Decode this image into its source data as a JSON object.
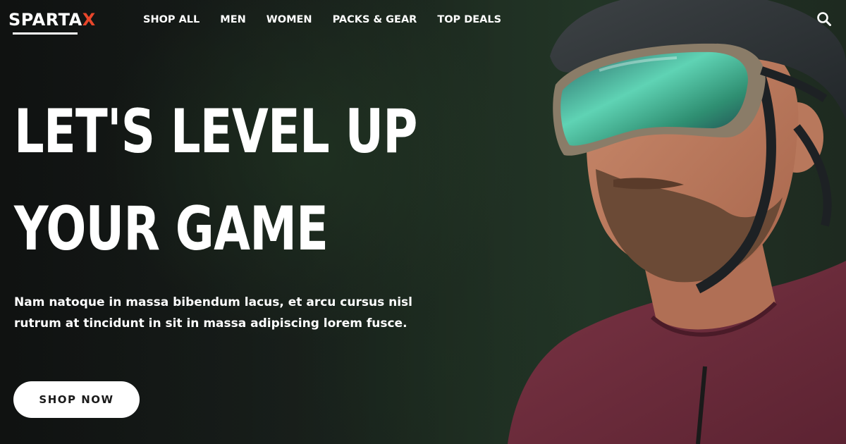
{
  "brand": {
    "logo_main": "SPARTA",
    "logo_accent": "X",
    "accent_color": "#e8462b"
  },
  "nav": {
    "items": [
      {
        "label": "SHOP ALL"
      },
      {
        "label": "MEN"
      },
      {
        "label": "WOMEN"
      },
      {
        "label": "PACKS & GEAR"
      },
      {
        "label": "TOP DEALS"
      }
    ],
    "search_icon": "search-icon"
  },
  "hero": {
    "headline_line1": "LET'S LEVEL UP",
    "headline_line2": "YOUR GAME",
    "subcopy_line1": "Nam natoque in massa bibendum lacus, et arcu cursus nisl",
    "subcopy_line2": "rutrum at tincidunt in sit in massa adipiscing lorem fusce.",
    "cta_label": "SHOP NOW",
    "background_color": "#1c241f"
  }
}
